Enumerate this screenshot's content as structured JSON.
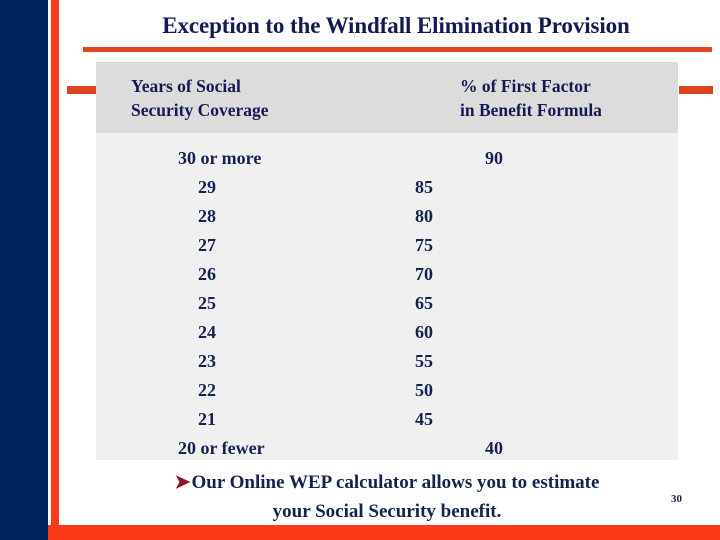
{
  "slide": {
    "title": "Exception to the Windfall Elimination Provision",
    "slide_number": "30",
    "colors": {
      "navy_panel": "#02245c",
      "red_bar": "#fa3a18",
      "rule_red": "#e0431d",
      "text_navy": "#152250",
      "header_bg": "#dcdcdc",
      "body_bg": "#f0f0f0",
      "bullet_red": "#8b1526"
    }
  },
  "table": {
    "headers": {
      "left_line1": "Years of Social",
      "left_line2": "Security Coverage",
      "right_line1": "% of First Factor",
      "right_line2": "in Benefit Formula"
    },
    "column_headers": [
      "Years of Social Security Coverage",
      "% of First Factor in Benefit Formula"
    ],
    "rows": [
      {
        "years": "30 or more",
        "percent": "90",
        "wide": true
      },
      {
        "years": "29",
        "percent": "85",
        "wide": false
      },
      {
        "years": "28",
        "percent": "80",
        "wide": false
      },
      {
        "years": "27",
        "percent": "75",
        "wide": false
      },
      {
        "years": "26",
        "percent": "70",
        "wide": false
      },
      {
        "years": "25",
        "percent": "65",
        "wide": false
      },
      {
        "years": "24",
        "percent": "60",
        "wide": false
      },
      {
        "years": "23",
        "percent": "55",
        "wide": false
      },
      {
        "years": "22",
        "percent": "50",
        "wide": false
      },
      {
        "years": "21",
        "percent": "45",
        "wide": false
      },
      {
        "years": "20 or fewer",
        "percent": "40",
        "wide": true
      }
    ]
  },
  "caption": {
    "bullet_glyph": "➤",
    "line1": "Our Online WEP calculator allows you to estimate",
    "line2": "your Social Security benefit."
  }
}
